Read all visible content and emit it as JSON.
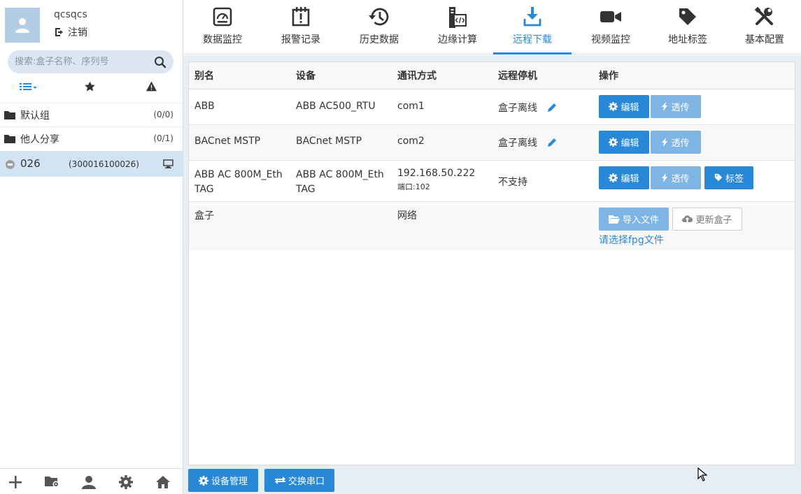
{
  "user": {
    "name": "qcsqcs",
    "logout_label": "注销"
  },
  "search": {
    "placeholder": "搜索:盒子名称、序列号"
  },
  "groups": [
    {
      "label": "默认组",
      "count": "(0/0)"
    },
    {
      "label": "他人分享",
      "count": "(0/1)"
    }
  ],
  "device": {
    "name": "026",
    "serial": "(300016100026)"
  },
  "nav": {
    "tabs": [
      {
        "label": "数据监控",
        "icon": "gauge-icon"
      },
      {
        "label": "报警记录",
        "icon": "alarm-log-icon"
      },
      {
        "label": "历史数据",
        "icon": "history-icon"
      },
      {
        "label": "边缘计算",
        "icon": "edge-compute-icon"
      },
      {
        "label": "远程下载",
        "icon": "download-icon"
      },
      {
        "label": "视频监控",
        "icon": "video-icon"
      },
      {
        "label": "地址标签",
        "icon": "tag-icon"
      },
      {
        "label": "基本配置",
        "icon": "tools-icon"
      }
    ],
    "active": "远程下载"
  },
  "table": {
    "headers": {
      "alias": "别名",
      "device": "设备",
      "comm": "通讯方式",
      "stop": "远程停机",
      "ops": "操作"
    },
    "rows": [
      {
        "alias": "ABB",
        "device": "ABB AC500_RTU",
        "comm": "com1",
        "stop": "盒子离线"
      },
      {
        "alias": "BACnet MSTP",
        "device": "BACnet MSTP",
        "comm": "com2",
        "stop": "盒子离线"
      },
      {
        "alias": "ABB AC 800M_EthTAG",
        "device": "ABB AC 800M_EthTAG",
        "comm": "192.168.50.222",
        "port": "端口:102",
        "stop": "不支持"
      },
      {
        "alias": "盒子",
        "comm": "网络"
      }
    ],
    "buttons": {
      "edit": "编辑",
      "passthrough": "透传",
      "tag": "标签",
      "import_file": "导入文件",
      "update_box": "更新盒子",
      "select_fpg": "请选择fpg文件"
    }
  },
  "footer": {
    "device_mgmt": "设备管理",
    "switch_serial": "交换串口"
  },
  "colors": {
    "primary": "#2a88d8",
    "light_primary": "#7fb5e4",
    "sidebar_selected": "#d2e3f4",
    "main_bg": "#e6edf3"
  }
}
